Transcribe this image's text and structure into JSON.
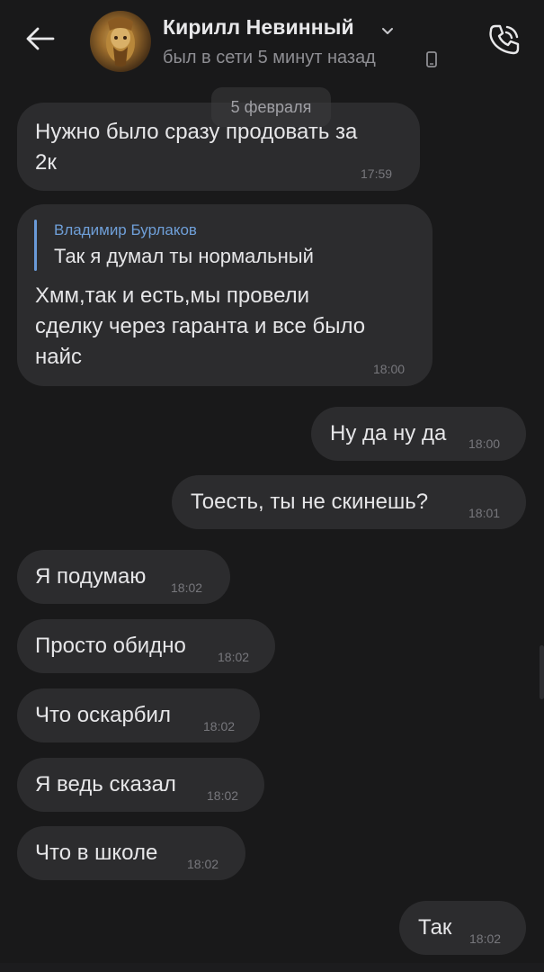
{
  "header": {
    "contact_name": "Кирилл Невинный",
    "status": "был в сети 5 минут назад"
  },
  "date_chip": "5 февраля",
  "messages": [
    {
      "lines": [
        "Нужно было сразу продовать за",
        "2к"
      ],
      "time": "17:59",
      "side": "in"
    },
    {
      "reply": {
        "author": "Владимир Бурлаков",
        "text": "Так я думал ты нормальный"
      },
      "lines": [
        "Хмм,так и есть,мы провели",
        "сделку через гаранта и все было",
        "найс"
      ],
      "time": "18:00",
      "side": "in"
    },
    {
      "lines": [
        "Ну да ну да"
      ],
      "time": "18:00",
      "side": "out"
    },
    {
      "lines": [
        "Тоесть, ты не скинешь?"
      ],
      "time": "18:01",
      "side": "out"
    },
    {
      "lines": [
        "Я подумаю"
      ],
      "time": "18:02",
      "side": "in"
    },
    {
      "lines": [
        "Просто обидно"
      ],
      "time": "18:02",
      "side": "in"
    },
    {
      "lines": [
        "Что оскарбил"
      ],
      "time": "18:02",
      "side": "in"
    },
    {
      "lines": [
        "Я ведь сказал"
      ],
      "time": "18:02",
      "side": "in"
    },
    {
      "lines": [
        "Что в школе"
      ],
      "time": "18:02",
      "side": "in"
    },
    {
      "lines": [
        "Так"
      ],
      "time": "18:02",
      "side": "out"
    }
  ],
  "colors": {
    "background": "#19191a",
    "bubble": "#2c2c2e",
    "reply_accent": "#6a9ad8"
  },
  "icons": [
    "back-arrow-icon",
    "chevron-down-icon",
    "mobile-phone-icon",
    "phone-call-icon"
  ]
}
